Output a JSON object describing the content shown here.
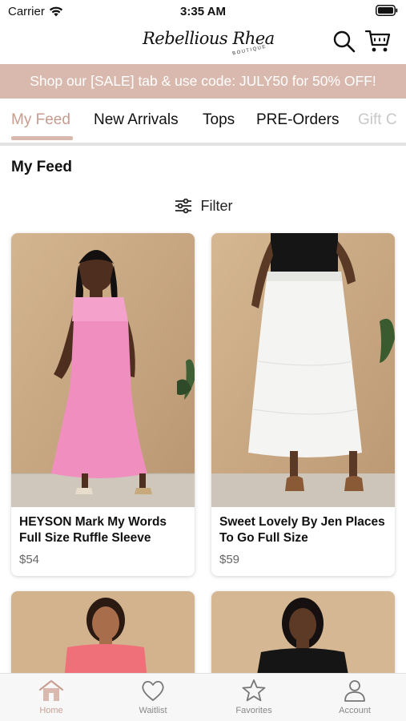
{
  "status_bar": {
    "carrier": "Carrier",
    "time": "3:35 AM"
  },
  "header": {
    "logo_text": "Rebellious Rhea",
    "logo_sub": "BOUTIQUE"
  },
  "promo_banner": {
    "text": "Shop our [SALE] tab & use code: JULY50 for 50% OFF!"
  },
  "tabs": [
    {
      "label": "My Feed",
      "active": true
    },
    {
      "label": "New Arrivals",
      "active": false
    },
    {
      "label": "Tops",
      "active": false
    },
    {
      "label": "PRE-Orders",
      "active": false
    },
    {
      "label": "Gift C",
      "active": false
    }
  ],
  "feed": {
    "title": "My Feed",
    "filter_label": "Filter"
  },
  "products": [
    {
      "name": "HEYSON Mark My Words Full Size Ruffle Sleeve",
      "price": "$54",
      "garment_color": "#f08fbf"
    },
    {
      "name": "Sweet Lovely By Jen Places To Go Full Size",
      "price": "$59",
      "garment_color": "#f4f4f2"
    },
    {
      "name": "",
      "price": "",
      "garment_color": "#f0707a"
    },
    {
      "name": "",
      "price": "",
      "garment_color": "#151515"
    }
  ],
  "bottom_nav": [
    {
      "label": "Home",
      "icon": "home-icon",
      "active": true
    },
    {
      "label": "Waitlist",
      "icon": "heart-icon",
      "active": false
    },
    {
      "label": "Favorites",
      "icon": "star-icon",
      "active": false
    },
    {
      "label": "Account",
      "icon": "person-icon",
      "active": false
    }
  ],
  "colors": {
    "accent": "#d9b9ae",
    "accent_text": "#c79c8f",
    "backdrop": "#c8a47e"
  }
}
